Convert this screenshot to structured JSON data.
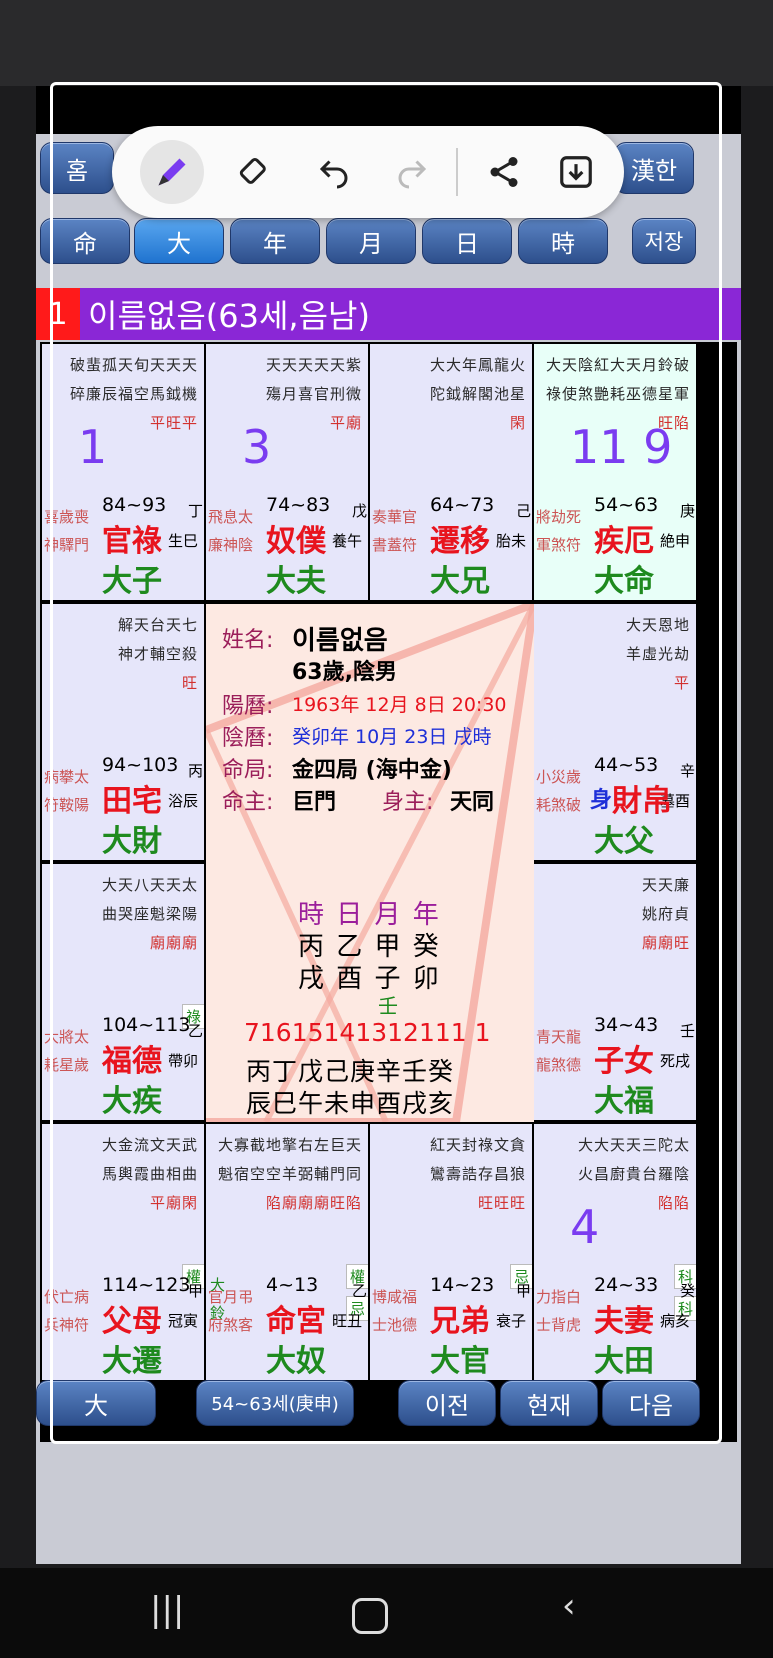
{
  "toolbar": {
    "icons": [
      "pen-icon",
      "eraser-icon",
      "undo-icon",
      "redo-icon",
      "share-icon",
      "save-icon"
    ]
  },
  "header": {
    "home": "홈",
    "hanja": "漢한"
  },
  "tabs": [
    "命",
    "大",
    "年",
    "月",
    "日",
    "時"
  ],
  "save_label": "저장",
  "name_bar": {
    "number": "1",
    "title": "이름없음(63세,음남)"
  },
  "cells": {
    "c1": {
      "stars": [
        "破蜚孤天旬天天天",
        "碎廉辰福空馬鉞機",
        "平旺平"
      ],
      "side": [
        "喜歲喪",
        "神驛門"
      ],
      "age": "84~93",
      "palace": "官祿",
      "gz1": "丁",
      "gz2": "生巳",
      "big": "大子",
      "hand": "1"
    },
    "c2": {
      "stars": [
        "天天天天天紫",
        "殤月喜官刑微",
        "平廟"
      ],
      "side": [
        "飛息太",
        "廉神陰"
      ],
      "age": "74~83",
      "palace": "奴僕",
      "gz1": "戊",
      "gz2": "養午",
      "big": "大夫",
      "hand": "3"
    },
    "c3": {
      "stars": [
        "大大年鳳龍火",
        "陀鉞解閣池星",
        "閑"
      ],
      "side": [
        "奏華官",
        "書蓋符"
      ],
      "age": "64~73",
      "palace": "遷移",
      "gz1": "己",
      "gz2": "胎未",
      "big": "大兄"
    },
    "c4": {
      "stars": [
        "大天陰紅大天月鈴破",
        "祿使煞艷耗巫德星軍",
        "旺陷"
      ],
      "side": [
        "將劫死",
        "軍煞符"
      ],
      "age": "54~63",
      "palace": "疾厄",
      "gz1": "庚",
      "gz2": "絶申",
      "big": "大命",
      "hand": "11 9"
    },
    "c5": {
      "stars": [
        "解天台天七",
        "神才輔空殺",
        "旺"
      ],
      "side": [
        "病攀太",
        "符鞍陽"
      ],
      "age": "94~103",
      "palace": "田宅",
      "gz1": "丙",
      "gz2": "浴辰",
      "big": "大財"
    },
    "c6": {
      "stars": [
        "大天恩地",
        "羊虛光劫",
        "平"
      ],
      "side": [
        "小災歲",
        "耗煞破"
      ],
      "age": "44~53",
      "palace": "財帛",
      "prefix": "身",
      "gz1": "辛",
      "gz2": "墓酉",
      "big": "大父"
    },
    "c7": {
      "stars": [
        "大天八天天太",
        "曲哭座魁梁陽",
        "廟廟廟"
      ],
      "badge": "祿",
      "side": [
        "大將太",
        "耗星歲"
      ],
      "age": "104~113",
      "palace": "福德",
      "gz1": "乙",
      "gz2": "帶卯",
      "big": "大疾"
    },
    "c8": {
      "stars": [
        "天天廉",
        "姚府貞",
        "廟廟旺"
      ],
      "side": [
        "青天龍",
        "龍煞德"
      ],
      "age": "34~43",
      "palace": "子女",
      "gz1": "壬",
      "gz2": "死戌",
      "big": "大福"
    },
    "c9": {
      "stars": [
        "大金流文天武",
        "馬輿霞曲相曲",
        "平廟閑"
      ],
      "badge": "權",
      "side": [
        "伏亡病",
        "兵神符"
      ],
      "age": "114~123",
      "palace": "父母",
      "gz1": "甲",
      "gz2": "冠寅",
      "big": "大遷"
    },
    "c10": {
      "stars": [
        "大寡截地擎右左巨天",
        "魁宿空空羊弼輔門同",
        "陷廟廟廟旺陷"
      ],
      "badge": "權",
      "badge2": "忌",
      "extra": [
        "大",
        "鈴"
      ],
      "side": [
        "官月弔",
        "府煞客"
      ],
      "age": "4~13",
      "palace": "命宮",
      "gz1": "乙",
      "gz2": "旺丑",
      "big": "大奴"
    },
    "c11": {
      "stars": [
        "紅天封祿文貪",
        "鸞壽誥存昌狼",
        "旺旺旺"
      ],
      "badge": "忌",
      "side": [
        "博咸福",
        "士池德"
      ],
      "age": "14~23",
      "palace": "兄弟",
      "gz1": "甲",
      "gz2": "衰子",
      "big": "大官"
    },
    "c12": {
      "stars": [
        "大大天天三陀太",
        "火昌廚貴台羅陰",
        "陷陷"
      ],
      "badge": "科",
      "badge2": "科",
      "side": [
        "力指白",
        "士背虎"
      ],
      "age": "24~33",
      "palace": "夫妻",
      "gz1": "癸",
      "gz2": "病亥",
      "big": "大田",
      "hand": "4"
    }
  },
  "center": {
    "name_label": "姓名:",
    "name": "이름없음",
    "age_sex": "63歲,陰男",
    "solar_label": "陽曆:",
    "solar": "1963年 12月 8日 20:30",
    "lunar_label": "陰曆:",
    "lunar": "癸卯年 10月 23日 戌時",
    "bureau_label": "命局:",
    "bureau": "金四局 (海中金)",
    "master_label": "命主:",
    "master": "巨門",
    "body_label": "身主:",
    "body": "天同",
    "pillar_head": "時 日 月 年",
    "pillar_stem": "丙 乙 甲 癸",
    "pillar_branch": "戌 酉 子 卯",
    "pillar_extra": "壬",
    "daeun_ages": "71615141312111 1",
    "daeun_stems": "丙丁戊己庚辛壬癸",
    "daeun_branches": "辰巳午未申酉戌亥"
  },
  "bottom": {
    "b1": "大",
    "b2": "54~63세(庚申)",
    "b3": "이전",
    "b4": "현재",
    "b5": "다음"
  }
}
